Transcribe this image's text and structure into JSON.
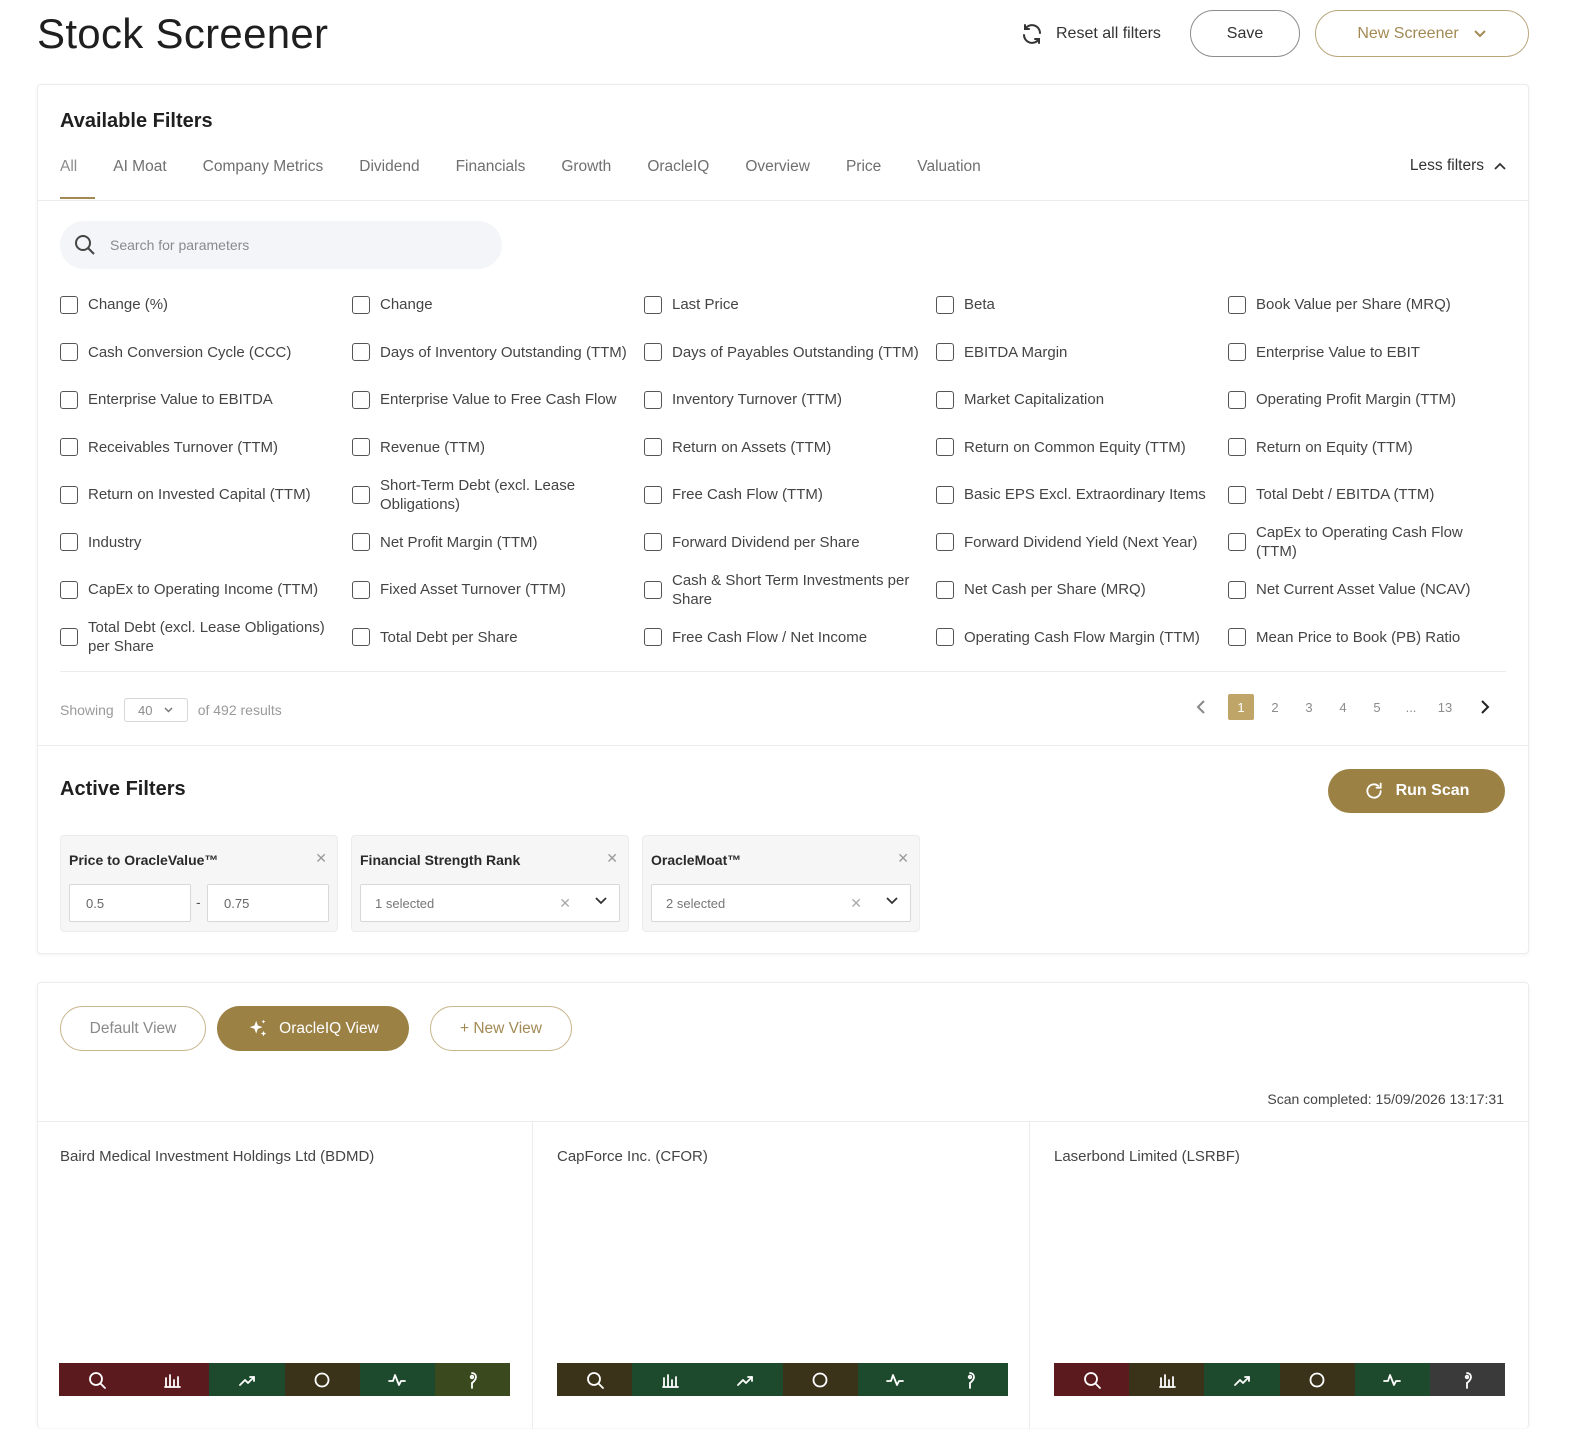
{
  "header": {
    "title": "Stock Screener",
    "reset_label": "Reset all filters",
    "save_label": "Save",
    "new_screener_label": "New Screener"
  },
  "available_filters": {
    "title": "Available Filters",
    "tabs": [
      "All",
      "AI Moat",
      "Company Metrics",
      "Dividend",
      "Financials",
      "Growth",
      "OracleIQ",
      "Overview",
      "Price",
      "Valuation"
    ],
    "active_tab": "All",
    "less_filters_label": "Less filters",
    "search_placeholder": "Search for parameters",
    "filters": [
      "Change (%)",
      "Change",
      "Last Price",
      "Beta",
      "Book Value per Share (MRQ)",
      "Cash Conversion Cycle (CCC)",
      "Days of Inventory Outstanding (TTM)",
      "Days of Payables Outstanding (TTM)",
      "EBITDA Margin",
      "Enterprise Value to EBIT",
      "Enterprise Value to EBITDA",
      "Enterprise Value to Free Cash Flow",
      "Inventory Turnover (TTM)",
      "Market Capitalization",
      "Operating Profit Margin (TTM)",
      "Receivables Turnover (TTM)",
      "Revenue (TTM)",
      "Return on Assets (TTM)",
      "Return on Common Equity (TTM)",
      "Return on Equity (TTM)",
      "Return on Invested Capital (TTM)",
      "Short-Term Debt (excl. Lease Obligations)",
      "Free Cash Flow (TTM)",
      "Basic EPS Excl. Extraordinary Items",
      "Total Debt / EBITDA (TTM)",
      "Industry",
      "Net Profit Margin (TTM)",
      "Forward Dividend per Share",
      "Forward Dividend Yield (Next Year)",
      "CapEx to Operating Cash Flow (TTM)",
      "CapEx to Operating Income (TTM)",
      "Fixed Asset Turnover (TTM)",
      "Cash & Short Term Investments per Share",
      "Net Cash per Share (MRQ)",
      "Net Current Asset Value (NCAV)",
      "Total Debt (excl. Lease Obligations) per Share",
      "Total Debt per Share",
      "Free Cash Flow / Net Income",
      "Operating Cash Flow Margin (TTM)",
      "Mean Price to Book (PB) Ratio"
    ],
    "pagination": {
      "showing_label": "Showing",
      "per_page": "40",
      "results_label": "of 492 results",
      "pages": [
        "1",
        "2",
        "3",
        "4",
        "5",
        "...",
        "13"
      ],
      "current_page": "1"
    }
  },
  "active_filters": {
    "title": "Active Filters",
    "run_scan_label": "Run Scan",
    "items": [
      {
        "name": "Price to OracleValue™",
        "min": "0.5",
        "max": "0.75"
      },
      {
        "name": "Financial Strength Rank",
        "value": "1 selected"
      },
      {
        "name": "OracleMoat™",
        "value": "2 selected"
      }
    ]
  },
  "results": {
    "views": [
      "Default View",
      "OracleIQ View",
      "+ New View"
    ],
    "active_view": "OracleIQ View",
    "scan_completed": "Scan completed: 15/09/2026 13:17:31",
    "companies": [
      {
        "name": "Baird Medical Investment Holdings Ltd (BDMD)",
        "bar_colors": [
          "#5b1a1e",
          "#5b1a1e",
          "#1d4a2c",
          "#3a3319",
          "#1d4a2c",
          "#3b4a1e"
        ]
      },
      {
        "name": "CapForce Inc. (CFOR)",
        "bar_colors": [
          "#3a3319",
          "#1d4a2c",
          "#1d4a2c",
          "#3a3319",
          "#1d4a2c",
          "#1d4a2c"
        ]
      },
      {
        "name": "Laserbond Limited (LSRBF)",
        "bar_colors": [
          "#5b1a1e",
          "#3a3319",
          "#1d4a2c",
          "#3a3319",
          "#1d4a2c",
          "#3a3a3a"
        ]
      }
    ],
    "bar_icons": [
      "search-icon",
      "bar-chart-icon",
      "trend-up-icon",
      "circle-icon",
      "pulse-icon",
      "pin-icon"
    ]
  },
  "colors": {
    "accent_gold": "#9c8145",
    "border_gold": "#b9a67b",
    "active_page": "#bfa568"
  }
}
